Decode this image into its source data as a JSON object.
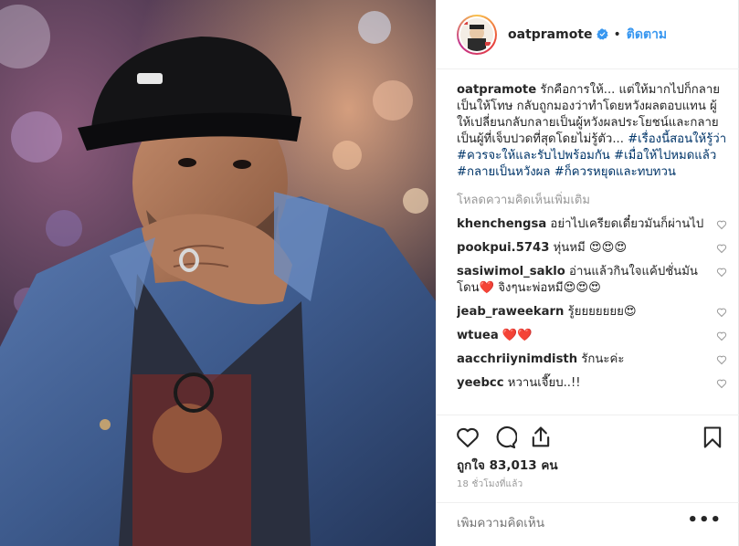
{
  "header": {
    "username": "oatpramote",
    "separator": "•",
    "follow_label": "ติดตาม"
  },
  "caption": {
    "username": "oatpramote",
    "text": "รักคือการให้... แต่ให้มากไปก็กลายเป็นให้โทษ กลับถูกมองว่าทำโดยหวังผลตอบแทน ผู้ให้เปลี่ยนกลับกลายเป็นผู้หวังผลประโยชน์และกลายเป็นผู้ที่เจ็บปวดที่สุดโดยไม่รู้ตัว... ",
    "hashtags": [
      "#เรื่องนี้สอนให้รู้ว่า",
      "#ควรจะให้และรับไปพร้อมกัน",
      "#เมื่อให้ไปหมดแล้ว",
      "#กลายเป็นหวังผล",
      "#ก็ควรหยุดและทบทวน"
    ]
  },
  "load_more_label": "โหลดความคิดเห็นเพิ่มเติม",
  "comments": [
    {
      "username": "khenchengsa",
      "text": "อย่าไปเครียดเดี๋ยวมันก็ผ่านไป"
    },
    {
      "username": "pookpui.5743",
      "text": "หุ่นหมี 😍😍😍"
    },
    {
      "username": "sasiwimol_saklo",
      "text": "อ่านแล้วกินใจแค้ปชั่นมันโดน❤️ จิงๆนะพ่อหมี😍😍😍"
    },
    {
      "username": "jeab_raweekarn",
      "text": "รู้ยยยยยยย😍"
    },
    {
      "username": "wtuea",
      "text": "❤️❤️"
    },
    {
      "username": "aacchriiynimdisth",
      "text": "รักนะค่ะ"
    },
    {
      "username": "yeebcc",
      "text": "หวานเจี๊ยบ..!!"
    }
  ],
  "likes": {
    "prefix": "ถูกใจ",
    "count": "83,013",
    "suffix": "คน"
  },
  "timestamp": "18 ชั่วโมงที่แล้ว",
  "add_comment_placeholder": "เพิ่มความคิดเห็น",
  "more_label": "•••",
  "icons": {
    "like": "heart-outline-icon",
    "comment": "comment-bubble-icon",
    "share": "share-icon",
    "save": "bookmark-icon",
    "verified": "verified-badge-icon"
  },
  "colors": {
    "accent": "#3897f0",
    "hashtag": "#003569",
    "muted": "#999999",
    "text": "#262626"
  }
}
